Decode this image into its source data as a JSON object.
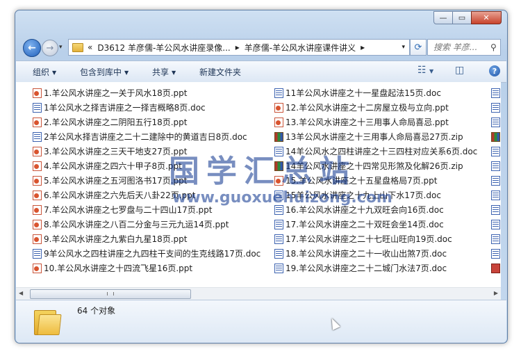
{
  "address": {
    "overflow": "«",
    "path": [
      "D3612 羊彦儒-羊公风水讲座录像...",
      "羊彦儒-羊公风水讲座课件讲义"
    ],
    "separator": "▸"
  },
  "search": {
    "placeholder": "搜索 羊彦..."
  },
  "toolbar": {
    "organize": "组织",
    "include_library": "包含到库中",
    "share": "共享",
    "new_folder": "新建文件夹"
  },
  "files_col1": [
    {
      "name": "1.羊公风水讲座之一关于风水18页.ppt",
      "type": "ppt"
    },
    {
      "name": "1羊公风水之择吉讲座之一择吉概略8页.doc",
      "type": "doc"
    },
    {
      "name": "2.羊公风水讲座之二阴阳五行18页.ppt",
      "type": "ppt"
    },
    {
      "name": "2羊公风水择吉讲座之二十二建除中的黄道吉日8页.doc",
      "type": "doc"
    },
    {
      "name": "3.羊公风水讲座之三天干地支27页.ppt",
      "type": "ppt"
    },
    {
      "name": "4.羊公风水讲座之四六十甲子8页.ppt",
      "type": "ppt"
    },
    {
      "name": "5.羊公风水讲座之五河图洛书17页.ppt",
      "type": "ppt"
    },
    {
      "name": "6.羊公风水讲座之六先后天八卦22页.ppt",
      "type": "ppt"
    },
    {
      "name": "7.羊公风水讲座之七罗盘与二十四山17页.ppt",
      "type": "ppt"
    },
    {
      "name": "8.羊公风水讲座之八百二分金与三元九运14页.ppt",
      "type": "ppt"
    },
    {
      "name": "9.羊公风水讲座之九紫白九星18页.ppt",
      "type": "ppt"
    },
    {
      "name": "9羊公风水之四柱讲座之九四柱干支间的生克线路17页.doc",
      "type": "doc"
    },
    {
      "name": "10.羊公风水讲座之十四流飞星16页.ppt",
      "type": "ppt"
    }
  ],
  "files_col2": [
    {
      "name": "11羊公风水讲座之十一星盘起法15页.doc",
      "type": "doc"
    },
    {
      "name": "12.羊公风水讲座之十二房屋立极与立向.ppt",
      "type": "ppt"
    },
    {
      "name": "13.羊公风水讲座之十三用事人命局喜忌.ppt",
      "type": "ppt"
    },
    {
      "name": "13羊公风水讲座之十三用事人命局喜忌27页.zip",
      "type": "zip"
    },
    {
      "name": "14羊公风水之四柱讲座之十三四柱对应关系6页.doc",
      "type": "doc"
    },
    {
      "name": "14羊公风水讲座之十四常见形煞及化解26页.zip",
      "type": "zip"
    },
    {
      "name": "15.羊公风水讲座之十五星盘格局7页.ppt",
      "type": "ppt"
    },
    {
      "name": "15羊公风水讲座之十九上山下水17页.doc",
      "type": "doc"
    },
    {
      "name": "16.羊公风水讲座之十九双旺会向16页.doc",
      "type": "doc"
    },
    {
      "name": "17.羊公风水讲座之二十双旺会坐14页.doc",
      "type": "doc"
    },
    {
      "name": "17.羊公风水讲座之二十七旺山旺向19页.doc",
      "type": "doc"
    },
    {
      "name": "18.羊公风水讲座之二十一收山出煞7页.doc",
      "type": "doc"
    },
    {
      "name": "19.羊公风水讲座之二十二城门水法7页.doc",
      "type": "doc"
    }
  ],
  "col3_types": [
    "doc",
    "doc",
    "doc",
    "zip",
    "doc",
    "doc",
    "doc",
    "doc",
    "doc",
    "doc",
    "doc",
    "doc",
    "tif"
  ],
  "status": {
    "count": "64 个对象"
  },
  "watermark": {
    "text": "国学汇总站",
    "url": "www.guoxuehuizong.com"
  },
  "window_controls": {
    "minimize": "—",
    "maximize": "▭",
    "close": "✕"
  },
  "nav": {
    "back": "←",
    "forward": "→",
    "dropdown": "▾"
  }
}
